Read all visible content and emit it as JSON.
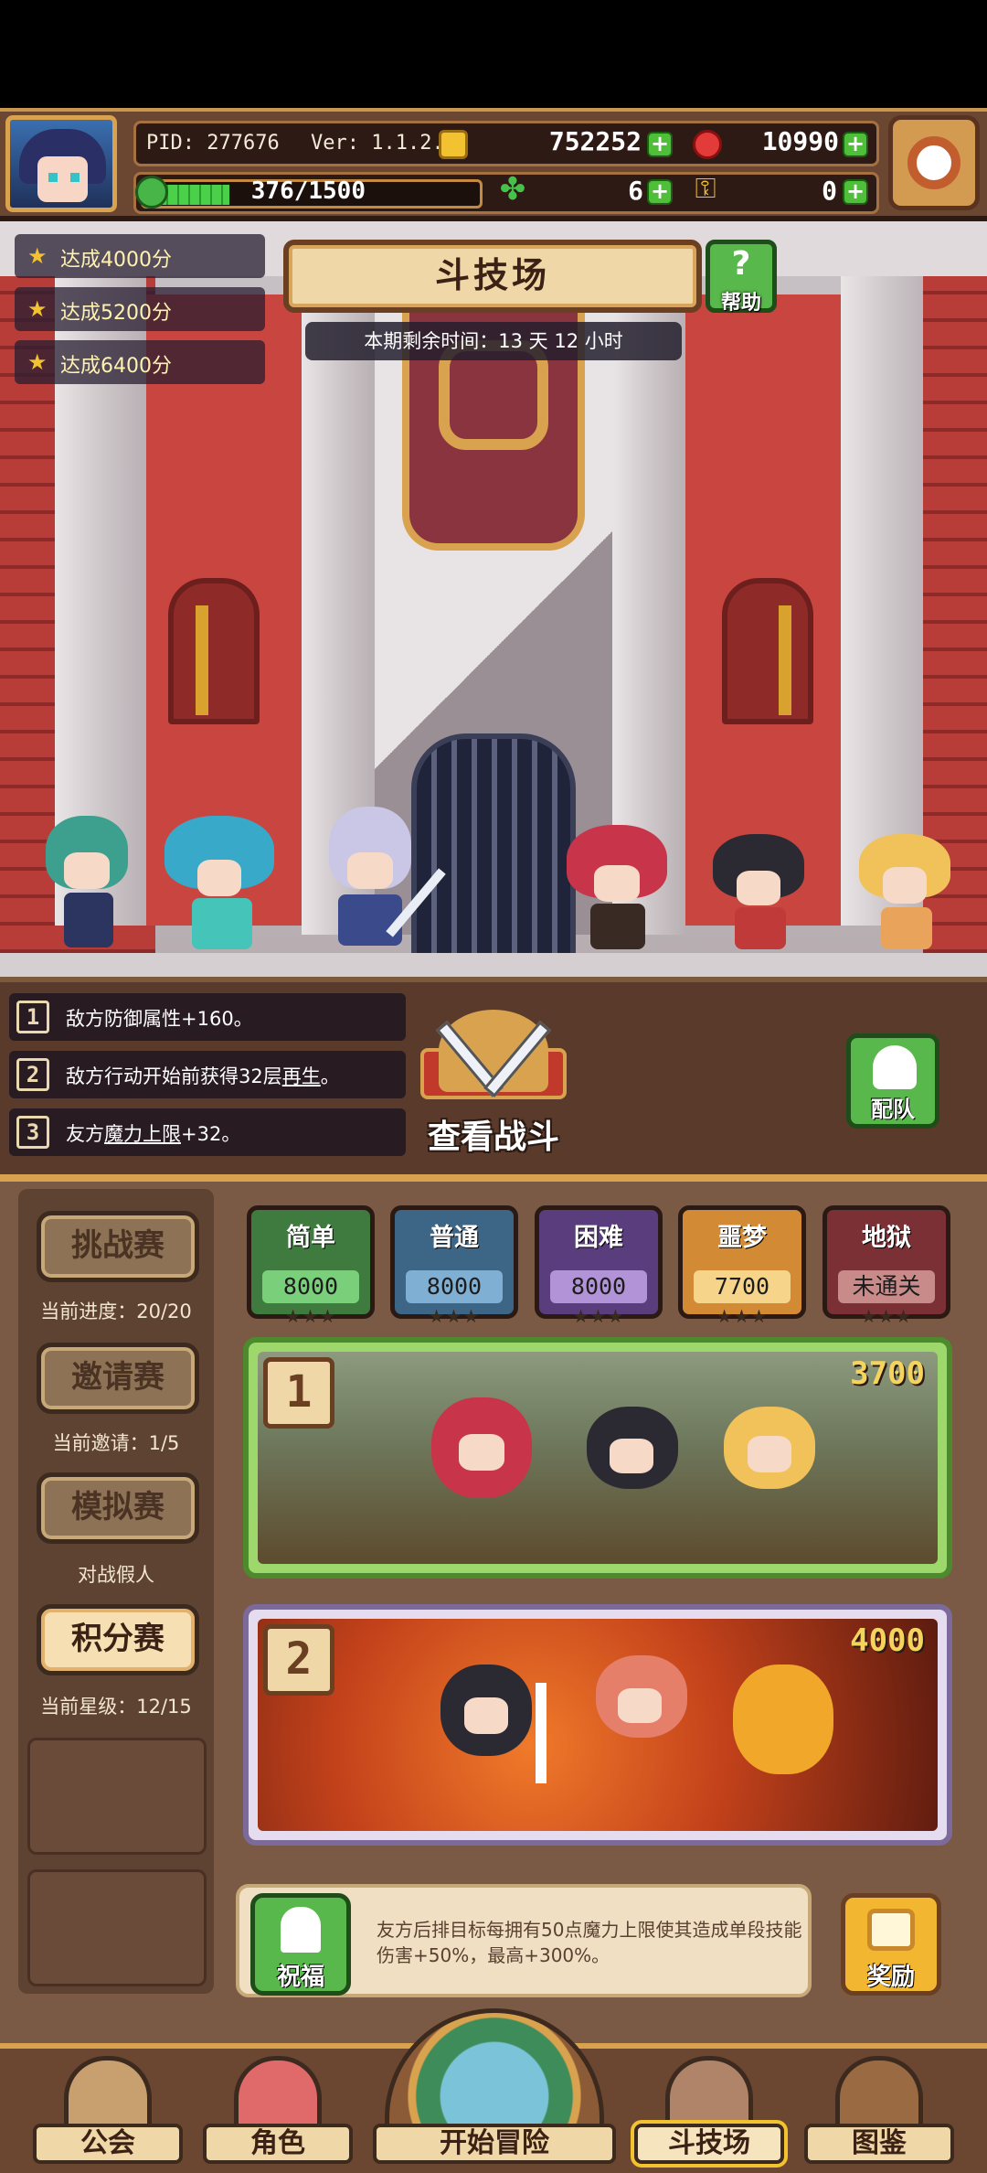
{
  "hud": {
    "pid": "PID: 277676",
    "version": "Ver: 1.1.2.5",
    "gold": "752252",
    "gems": "10990",
    "stamina": "376/1500",
    "stamina_ratio": 0.25,
    "clover_count": "6",
    "key_count": "0",
    "icons": [
      "avatar",
      "coin-icon",
      "gem-icon",
      "leaf-icon",
      "clover-icon",
      "key-icon",
      "settings-icon"
    ]
  },
  "missions": [
    {
      "label": "达成4000分"
    },
    {
      "label": "达成5200分"
    },
    {
      "label": "达成6400分"
    }
  ],
  "arena": {
    "title": "斗技场",
    "help_label": "帮助",
    "timer": "本期剩余时间：13 天 12 小时"
  },
  "rules": [
    {
      "num": "1",
      "text": "敌方防御属性+160。"
    },
    {
      "num": "2",
      "pre": "敌方行动开始前获得32层",
      "link": "再生",
      "post": "。"
    },
    {
      "num": "3",
      "pre": "友方",
      "link": "魔力上限",
      "post": "+32。"
    }
  ],
  "battle": {
    "view_label": "查看战斗",
    "team_label": "配队"
  },
  "modes": [
    {
      "label": "挑战赛",
      "sub": "当前进度：20/20"
    },
    {
      "label": "邀请赛",
      "sub": "当前邀请：1/5"
    },
    {
      "label": "模拟赛",
      "sub": "对战假人"
    },
    {
      "label": "积分赛",
      "sub": "当前星级：12/15"
    }
  ],
  "difficulties": [
    {
      "name": "简单",
      "value": "8000",
      "stars": "★★★",
      "color": "#3f7a3e",
      "box": "#7ad07a"
    },
    {
      "name": "普通",
      "value": "8000",
      "stars": "★★★",
      "color": "#3d6585",
      "box": "#7fb0d4"
    },
    {
      "name": "困难",
      "value": "8000",
      "stars": "★★★",
      "color": "#5a3d7d",
      "box": "#b293d8"
    },
    {
      "name": "噩梦",
      "value": "7700",
      "stars": "★★★",
      "color": "#d28a34",
      "box": "#f6d58a"
    },
    {
      "name": "地狱",
      "value": "未通关",
      "stars": "★★★",
      "color": "#7a3034",
      "box": "#c98a8a"
    }
  ],
  "opponents": [
    {
      "rank": "1",
      "score": "3700"
    },
    {
      "rank": "2",
      "score": "4000"
    }
  ],
  "buff": {
    "bless_label": "祝福",
    "text": "友方后排目标每拥有50点魔力上限使其造成单段技能伤害+50%，最高+300%。",
    "reward_label": "奖励"
  },
  "nav": [
    {
      "label": "公会"
    },
    {
      "label": "角色"
    },
    {
      "label": "开始冒险"
    },
    {
      "label": "斗技场"
    },
    {
      "label": "图鉴"
    }
  ]
}
